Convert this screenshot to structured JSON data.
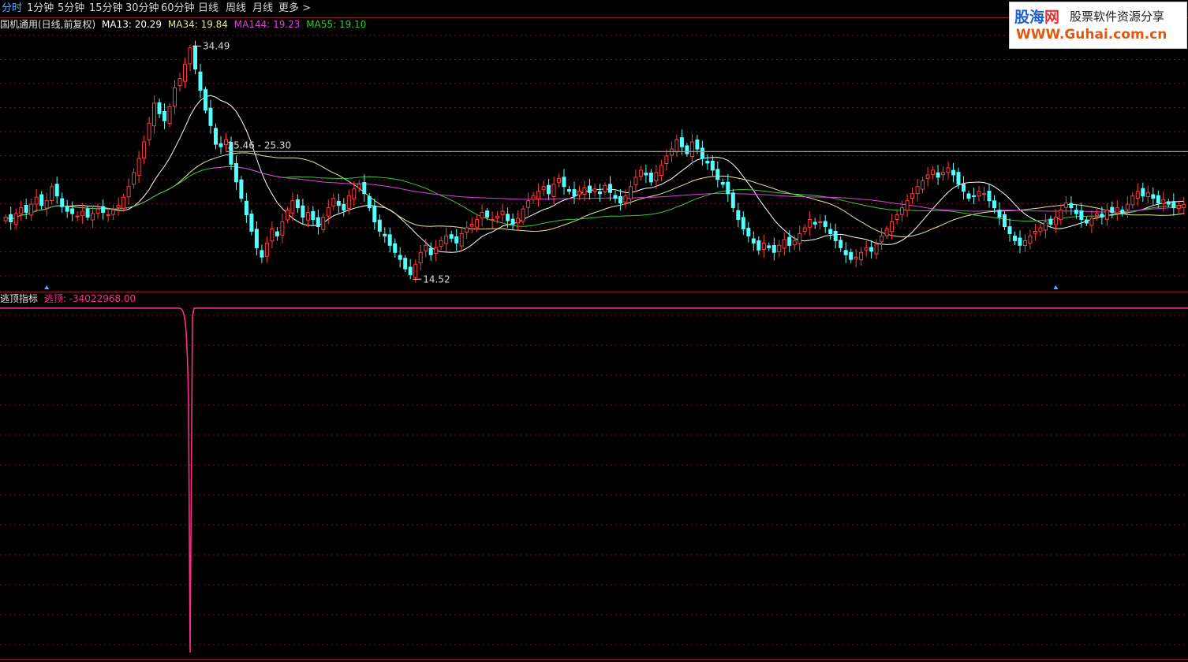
{
  "toolbar": {
    "items": [
      "分时",
      "1分钟",
      "5分钟",
      "15分钟",
      "30分钟",
      "60分钟",
      "日线",
      "周线",
      "月线",
      "更多 >"
    ],
    "active_index": 0
  },
  "watermark": {
    "line1_blue": "股海",
    "line1_red": "网",
    "line2": "股票软件资源分享",
    "url": "WWW.Guhai.com.cn"
  },
  "main_legend": {
    "stock": "国机通用(日线,前复权)",
    "ma13": "MA13: 20.29",
    "ma34": "MA34: 19.84",
    "ma144": "MA144: 19.23",
    "ma55": "MA55: 19.10"
  },
  "indicator_legend": {
    "name": "逃顶指标",
    "series": "逃顶: -34022968.00"
  },
  "colors": {
    "up": "#ff3c3c",
    "down": "#54ffff",
    "ma13": "#ffffff",
    "ma34": "#e6e69a",
    "ma55": "#3ac83a",
    "ma144": "#e040e0",
    "indicator": "#ff2d8a",
    "grid": "#7a1020",
    "border": "#8b1e2e",
    "hline": "#a0a0a0"
  },
  "chart_data": [
    {
      "type": "candlestick",
      "annotations": {
        "high_label": "34.49",
        "low_label": "14.52",
        "hline_label": "25.46 - 25.30"
      },
      "closes": [
        19.8,
        19.4,
        20.1,
        20.6,
        20.2,
        20.9,
        21.5,
        20.8,
        21.2,
        22.4,
        21.6,
        20.7,
        20.3,
        20.1,
        19.9,
        20.3,
        19.8,
        20.1,
        20.5,
        20.2,
        20.0,
        20.4,
        20.8,
        21.5,
        22.4,
        23.6,
        24.8,
        26.2,
        27.8,
        29.5,
        28.6,
        28.0,
        29.2,
        30.8,
        31.6,
        32.8,
        34.2,
        32.4,
        30.6,
        28.9,
        27.6,
        26.0,
        25.8,
        26.4,
        24.3,
        22.8,
        21.4,
        20.0,
        18.6,
        17.2,
        16.4,
        17.6,
        18.8,
        18.2,
        19.4,
        20.4,
        21.2,
        20.6,
        19.8,
        20.2,
        19.6,
        19.0,
        19.8,
        20.6,
        21.4,
        20.8,
        20.4,
        21.6,
        22.2,
        22.6,
        21.8,
        20.6,
        19.4,
        18.6,
        18.2,
        17.4,
        16.8,
        16.2,
        15.4,
        14.9,
        15.8,
        16.8,
        17.4,
        16.6,
        17.2,
        17.8,
        18.2,
        18.0,
        17.6,
        18.4,
        18.9,
        19.2,
        19.6,
        20.2,
        19.8,
        19.6,
        19.9,
        20.3,
        19.5,
        19.2,
        19.7,
        20.5,
        21.2,
        21.6,
        22.0,
        22.4,
        21.8,
        22.6,
        23.1,
        22.4,
        22.0,
        21.6,
        22.0,
        22.3,
        21.9,
        22.2,
        21.8,
        22.5,
        21.9,
        21.4,
        21.0,
        21.6,
        22.4,
        23.2,
        23.8,
        23.4,
        22.8,
        23.6,
        24.2,
        25.0,
        25.6,
        26.4,
        25.8,
        25.2,
        26.2,
        25.6,
        24.8,
        24.4,
        23.8,
        23.0,
        22.6,
        21.8,
        20.6,
        19.6,
        18.8,
        18.2,
        17.6,
        17.0,
        17.6,
        17.2,
        16.8,
        17.4,
        17.9,
        17.4,
        17.8,
        18.4,
        18.9,
        19.6,
        19.2,
        19.4,
        19.0,
        18.4,
        17.8,
        17.2,
        16.6,
        16.2,
        16.4,
        16.8,
        17.2,
        16.9,
        17.5,
        18.2,
        18.8,
        19.4,
        20.0,
        20.6,
        21.2,
        21.8,
        22.4,
        22.9,
        23.4,
        23.8,
        23.2,
        23.6,
        24.0,
        23.4,
        22.6,
        22.0,
        21.4,
        21.6,
        22.0,
        21.8,
        21.2,
        20.6,
        19.8,
        19.0,
        18.4,
        17.8,
        17.4,
        17.8,
        18.2,
        18.6,
        18.9,
        19.4,
        19.2,
        19.8,
        20.4,
        21.0,
        20.6,
        20.1,
        19.6,
        19.3,
        19.7,
        20.1,
        19.8,
        20.4,
        20.2,
        20.6,
        20.2,
        20.9,
        21.6,
        22.0,
        21.6,
        21.9,
        21.4,
        21.0,
        21.3,
        20.9,
        20.6,
        20.8,
        20.9
      ],
      "ma_series": [
        "MA13",
        "MA34",
        "MA55",
        "MA144"
      ],
      "marker_days": [
        8,
        205
      ],
      "x_marks_days": [
        204,
        219,
        221,
        222,
        224,
        229
      ]
    },
    {
      "type": "line",
      "series": [
        {
          "name": "逃顶",
          "spike_index": 36,
          "baseline_value": 0,
          "spike_value": -34022968.0
        }
      ]
    }
  ]
}
